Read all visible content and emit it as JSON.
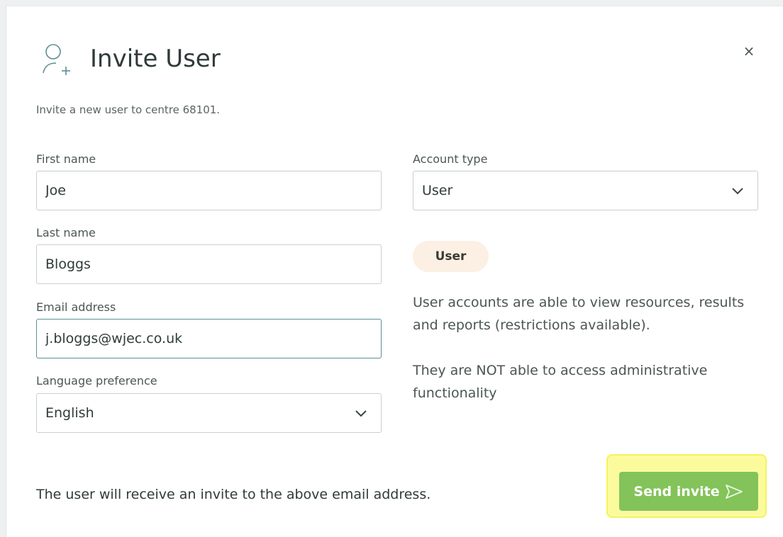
{
  "dialog": {
    "title": "Invite User",
    "subtitle": "Invite a new user to centre 68101.",
    "close_symbol": "×",
    "title_icon": "user-plus-icon",
    "close_icon": "close-icon"
  },
  "form": {
    "first_name": {
      "label": "First name",
      "value": "Joe"
    },
    "last_name": {
      "label": "Last name",
      "value": "Bloggs"
    },
    "email": {
      "label": "Email address",
      "value": "j.bloggs@wjec.co.uk"
    },
    "language": {
      "label": "Language preference",
      "value": "English"
    },
    "account_type": {
      "label": "Account type",
      "value": "User"
    }
  },
  "role_info": {
    "badge": "User",
    "description_1": "User accounts are able to view resources, results and reports (restrictions available).",
    "description_2": "They are NOT able to access administrative functionality"
  },
  "footer": {
    "note": "The user will receive an invite to the above email address.",
    "send_label": "Send invite",
    "send_icon": "send-icon"
  },
  "colors": {
    "accent_green": "#83c35a",
    "highlight_yellow": "#fbfb9e",
    "badge_bg": "#fcefe3",
    "focus_border": "#5c8f93"
  }
}
